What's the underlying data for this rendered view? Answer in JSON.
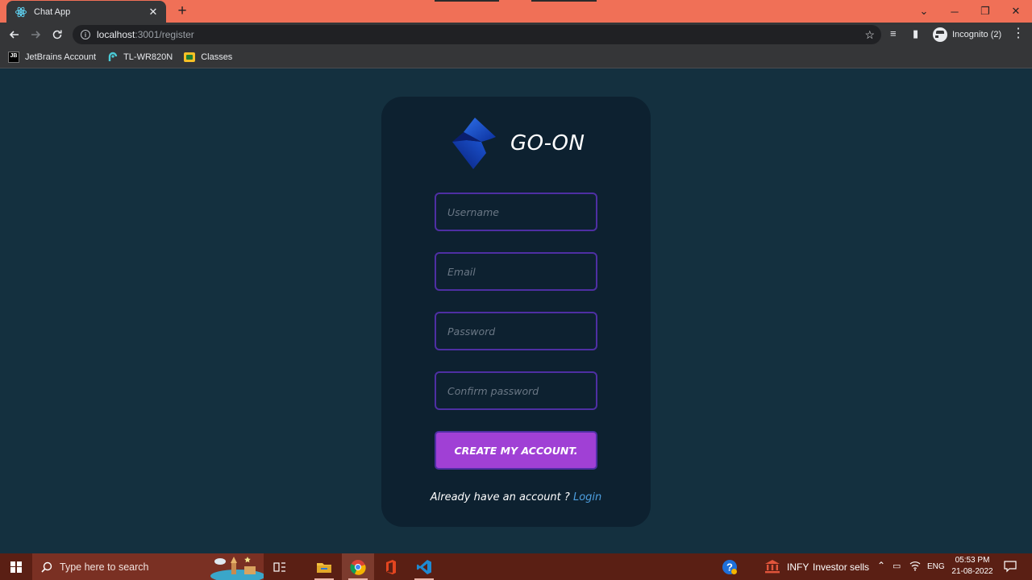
{
  "browser": {
    "tab": {
      "title": "Chat App",
      "close_label": "✕"
    },
    "new_tab_label": "+",
    "window_controls": {
      "minimize": "─",
      "maximize": "❐",
      "close": "✕",
      "tab_search": "⌄"
    },
    "url": {
      "host": "localhost",
      "path": ":3001/register"
    },
    "profile_label": "Incognito (2)",
    "bookmarks": [
      "JetBrains Account",
      "TL-WR820N",
      "Classes"
    ]
  },
  "app": {
    "brand": "GO-ON",
    "fields": {
      "username_placeholder": "Username",
      "email_placeholder": "Email",
      "password_placeholder": "Password",
      "confirm_placeholder": "Confirm password"
    },
    "submit_label": "CREATE MY ACCOUNT.",
    "login_prompt": "Already have an account ?",
    "login_link": "Login",
    "colors": {
      "background": "#14303f",
      "card": "#0d2130",
      "field_border": "#4e2fa3",
      "button": "#a040d5",
      "link": "#4d9fe0"
    }
  },
  "taskbar": {
    "search_placeholder": "Type here to search",
    "stock_ticker": "INFY",
    "stock_text": "Investor sells",
    "language": "ENG",
    "time": "05:53 PM",
    "date": "21-08-2022"
  }
}
